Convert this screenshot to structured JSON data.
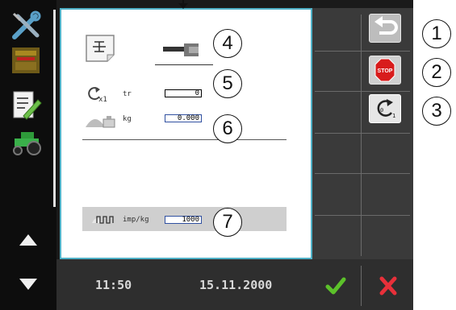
{
  "sidebar": {
    "items": [
      {
        "icon": "tools-icon"
      },
      {
        "icon": "terminal-panel-icon"
      },
      {
        "icon": "notepad-edit-icon"
      },
      {
        "icon": "tractor-icon"
      }
    ],
    "scroll_up_icon": "triangle-up-icon",
    "scroll_down_icon": "triangle-down-icon"
  },
  "main": {
    "calibration_icon": "scale-sheet-icon",
    "tool_icon": "sprayer-nozzle-icon",
    "rotation": {
      "icon": "rotation-x1-icon",
      "label": "tr",
      "value": "0",
      "multiplier": "x1"
    },
    "weight": {
      "icon": "heap-weight-icon",
      "label": "kg",
      "value": "0.000"
    },
    "impulse": {
      "label": "imp/kg",
      "value": "1000"
    }
  },
  "softkeys": {
    "back": {
      "icon": "return-arrow-icon"
    },
    "stop": {
      "icon": "stop-sign-icon",
      "label": "STOP"
    },
    "reset": {
      "icon": "reset-counter-icon",
      "zero": "0",
      "one": "1"
    }
  },
  "callouts": [
    "1",
    "2",
    "3",
    "4",
    "5",
    "6",
    "7"
  ],
  "status": {
    "time": "11:50",
    "date": "15.11.2000"
  },
  "actions": {
    "confirm_icon": "check-icon",
    "cancel_icon": "close-icon"
  },
  "colors": {
    "panel_border": "#4fb0c6",
    "confirm": "#5cc12a",
    "cancel": "#e8303a",
    "stop": "#d81c1c"
  }
}
